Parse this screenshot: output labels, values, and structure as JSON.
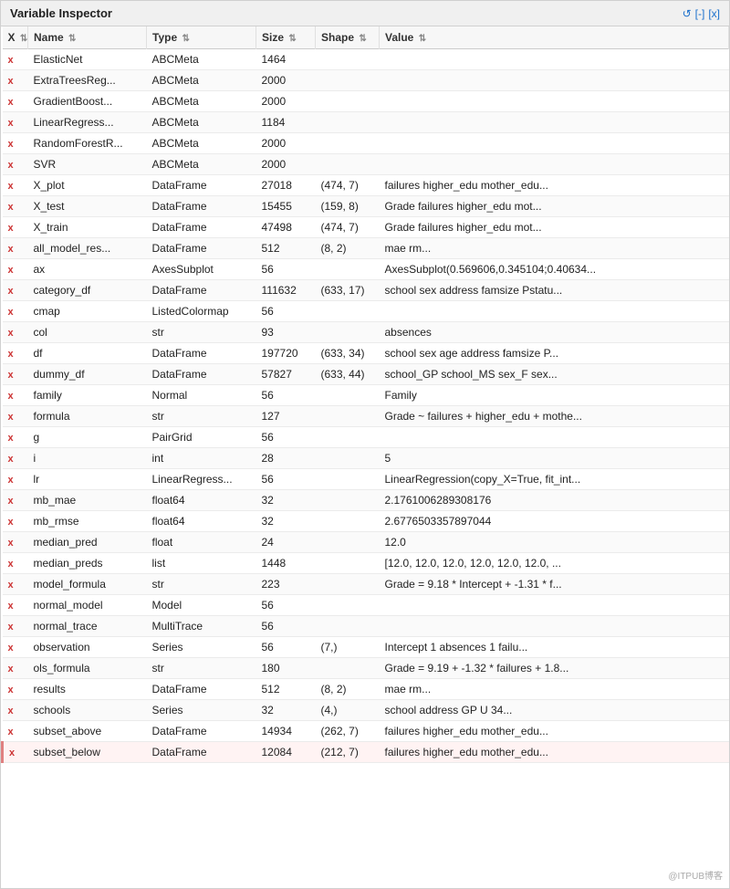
{
  "panel": {
    "title": "Variable Inspector",
    "controls": {
      "refresh": "↺",
      "minimize": "[-]",
      "close": "[x]"
    }
  },
  "table": {
    "columns": [
      {
        "id": "x",
        "label": "X",
        "class": "col-x"
      },
      {
        "id": "name",
        "label": "Name",
        "class": "col-name"
      },
      {
        "id": "type",
        "label": "Type",
        "class": "col-type"
      },
      {
        "id": "size",
        "label": "Size",
        "class": "col-size"
      },
      {
        "id": "shape",
        "label": "Shape",
        "class": "col-shape"
      },
      {
        "id": "value",
        "label": "Value",
        "class": "col-value"
      }
    ],
    "rows": [
      {
        "name": "ElasticNet",
        "type": "ABCMeta",
        "size": "1464",
        "shape": "",
        "value": ""
      },
      {
        "name": "ExtraTreesReg...",
        "type": "ABCMeta",
        "size": "2000",
        "shape": "",
        "value": ""
      },
      {
        "name": "GradientBoost...",
        "type": "ABCMeta",
        "size": "2000",
        "shape": "",
        "value": ""
      },
      {
        "name": "LinearRegress...",
        "type": "ABCMeta",
        "size": "1184",
        "shape": "",
        "value": ""
      },
      {
        "name": "RandomForestR...",
        "type": "ABCMeta",
        "size": "2000",
        "shape": "",
        "value": ""
      },
      {
        "name": "SVR",
        "type": "ABCMeta",
        "size": "2000",
        "shape": "",
        "value": ""
      },
      {
        "name": "X_plot",
        "type": "DataFrame",
        "size": "27018",
        "shape": "(474, 7)",
        "value": "failures higher_edu mother_edu..."
      },
      {
        "name": "X_test",
        "type": "DataFrame",
        "size": "15455",
        "shape": "(159, 8)",
        "value": "Grade failures higher_edu mot..."
      },
      {
        "name": "X_train",
        "type": "DataFrame",
        "size": "47498",
        "shape": "(474, 7)",
        "value": "Grade failures higher_edu mot..."
      },
      {
        "name": "all_model_res...",
        "type": "DataFrame",
        "size": "512",
        "shape": "(8, 2)",
        "value": "mae rm..."
      },
      {
        "name": "ax",
        "type": "AxesSubplot",
        "size": "56",
        "shape": "",
        "value": "AxesSubplot(0.569606,0.345104;0.40634..."
      },
      {
        "name": "category_df",
        "type": "DataFrame",
        "size": "111632",
        "shape": "(633, 17)",
        "value": "school sex address famsize Pstatu..."
      },
      {
        "name": "cmap",
        "type": "ListedColormap",
        "size": "56",
        "shape": "",
        "value": ""
      },
      {
        "name": "col",
        "type": "str",
        "size": "93",
        "shape": "",
        "value": "absences"
      },
      {
        "name": "df",
        "type": "DataFrame",
        "size": "197720",
        "shape": "(633, 34)",
        "value": "school sex age address famsize P..."
      },
      {
        "name": "dummy_df",
        "type": "DataFrame",
        "size": "57827",
        "shape": "(633, 44)",
        "value": "school_GP school_MS sex_F sex..."
      },
      {
        "name": "family",
        "type": "Normal",
        "size": "56",
        "shape": "",
        "value": "Family"
      },
      {
        "name": "formula",
        "type": "str",
        "size": "127",
        "shape": "",
        "value": "Grade ~ failures + higher_edu + mothe..."
      },
      {
        "name": "g",
        "type": "PairGrid",
        "size": "56",
        "shape": "",
        "value": ""
      },
      {
        "name": "i",
        "type": "int",
        "size": "28",
        "shape": "",
        "value": "5"
      },
      {
        "name": "lr",
        "type": "LinearRegress...",
        "size": "56",
        "shape": "",
        "value": "LinearRegression(copy_X=True, fit_int..."
      },
      {
        "name": "mb_mae",
        "type": "float64",
        "size": "32",
        "shape": "",
        "value": "2.1761006289308176"
      },
      {
        "name": "mb_rmse",
        "type": "float64",
        "size": "32",
        "shape": "",
        "value": "2.6776503357897044"
      },
      {
        "name": "median_pred",
        "type": "float",
        "size": "24",
        "shape": "",
        "value": "12.0"
      },
      {
        "name": "median_preds",
        "type": "list",
        "size": "1448",
        "shape": "",
        "value": "[12.0, 12.0, 12.0, 12.0, 12.0, 12.0, ..."
      },
      {
        "name": "model_formula",
        "type": "str",
        "size": "223",
        "shape": "",
        "value": "Grade = 9.18 * Intercept + -1.31 * f..."
      },
      {
        "name": "normal_model",
        "type": "Model",
        "size": "56",
        "shape": "",
        "value": ""
      },
      {
        "name": "normal_trace",
        "type": "MultiTrace",
        "size": "56",
        "shape": "",
        "value": ""
      },
      {
        "name": "observation",
        "type": "Series",
        "size": "56",
        "shape": "(7,)",
        "value": "Intercept 1 absences 1 failu..."
      },
      {
        "name": "ols_formula",
        "type": "str",
        "size": "180",
        "shape": "",
        "value": "Grade = 9.19 + -1.32 * failures + 1.8..."
      },
      {
        "name": "results",
        "type": "DataFrame",
        "size": "512",
        "shape": "(8, 2)",
        "value": "mae rm..."
      },
      {
        "name": "schools",
        "type": "Series",
        "size": "32",
        "shape": "(4,)",
        "value": "school address GP U 34..."
      },
      {
        "name": "subset_above",
        "type": "DataFrame",
        "size": "14934",
        "shape": "(262, 7)",
        "value": "failures higher_edu mother_edu..."
      },
      {
        "name": "subset_below",
        "type": "DataFrame",
        "size": "12084",
        "shape": "(212, 7)",
        "value": "failures higher_edu mother_edu..."
      }
    ]
  },
  "watermark": "@ITPUB博客"
}
